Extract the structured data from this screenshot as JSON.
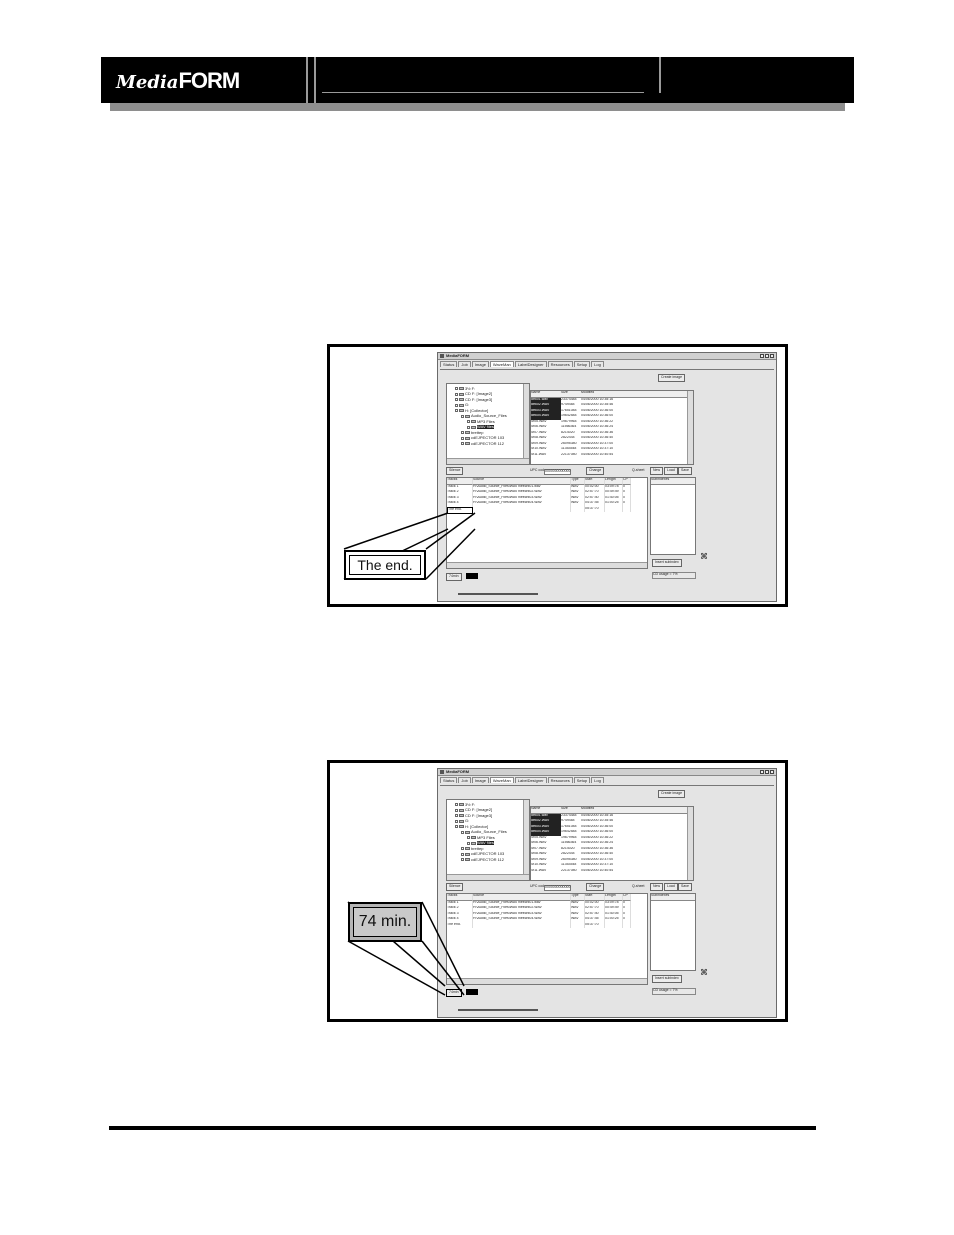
{
  "header": {
    "logo_part1": "Media",
    "logo_part2": "FORM"
  },
  "app": {
    "window_title": "MediaFORM",
    "tabs": [
      "Status",
      "Job",
      "Image",
      "WaveMan",
      "LabelDesigner",
      "Resources",
      "Setup",
      "Log"
    ],
    "create_image_button": "Create image",
    "tree_items": [
      "3½ F:",
      "CD F: [Image2]",
      "CD F: [Image3]",
      "G:",
      "H: [Collector]",
      "Audio_Source_Files",
      "MP3 Files",
      "WAV files",
      "brettep",
      "cdEJPECTOR 103",
      "cdEJPECTOR 112"
    ],
    "file_headers": [
      "Name",
      "Size",
      "Modified"
    ],
    "files": [
      [
        "dtrk01.wav",
        "23374484",
        "04/06/2000 10:35:16"
      ],
      [
        "dtrk02.WAV",
        "9749484",
        "04/06/2000 10:35:46"
      ],
      [
        "dtrk03.WAV",
        "17651084",
        "04/06/2000 10:36:00"
      ],
      [
        "dtrk04.WAV",
        "19642584",
        "04/06/2000 10:36:00"
      ],
      [
        "4r05.WAV",
        "19679964",
        "04/06/2000 10:36:22"
      ],
      [
        "4r06.WAV",
        "11566364",
        "04/06/2000 10:36:24"
      ],
      [
        "4r07.WAV",
        "8214020",
        "04/06/2000 10:36:36"
      ],
      [
        "4r08.WAV",
        "2822444",
        "04/06/2000 10:36:40"
      ],
      [
        "4r09.WAV",
        "26095380",
        "04/06/2000 10:37:00"
      ],
      [
        "4r10.WAV",
        "11353548",
        "04/06/2000 10:37:10"
      ],
      [
        "4r11.WAV",
        "22137080",
        "04/06/2000 10:40:54"
      ]
    ],
    "silence_button": "Silence",
    "upc_label": "UPC code",
    "upc_value": "0000000000000",
    "change_button": "Change",
    "q_sheet_label": "Q-sheet",
    "new_button": "New",
    "load_button": "Load",
    "save_button": "Save",
    "track_headers": [
      "Tracks",
      "Source",
      "Type",
      "Start",
      "Length",
      "CP"
    ],
    "tracks": [
      [
        "Track 1",
        "H:\\Audio_Source_Files\\WAV files\\trk01.wav",
        "WAV",
        "00:02:00",
        "03:09:78",
        "0"
      ],
      [
        "Track 2",
        "H:\\Audio_Source_Files\\WAV files\\trk02.WAV",
        "WAV",
        "02:57:70",
        "00:49:49",
        "0"
      ],
      [
        "Track 3",
        "H:\\Audio_Source_Files\\WAV files\\trk03.WAV",
        "WAV",
        "02:57:40",
        "01:40:05",
        "0"
      ],
      [
        "Track 4",
        "H:\\Audio_Source_Files\\WAV files\\trk04.WAV",
        "WAV",
        "04:37:45",
        "01:00:25",
        "0"
      ]
    ],
    "end_row_label": "The end.",
    "end_row_start": "05:37:70",
    "subindex_header": "Subindexes",
    "insert_subindex_button": "Insert subindex",
    "disc_button": "74min",
    "cd_usage": "CD usage = 7%"
  },
  "callouts": {
    "figure1_zoom_text": "The end.",
    "figure2_zoom_text": "74 min."
  }
}
